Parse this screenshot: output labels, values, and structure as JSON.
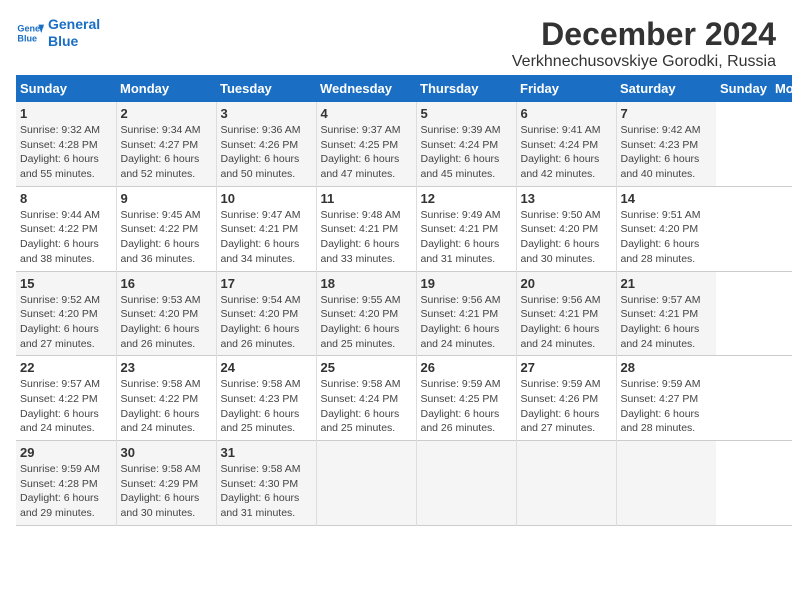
{
  "header": {
    "logo_line1": "General",
    "logo_line2": "Blue",
    "month_title": "December 2024",
    "location": "Verkhnechusovskiye Gorodki, Russia"
  },
  "days_of_week": [
    "Sunday",
    "Monday",
    "Tuesday",
    "Wednesday",
    "Thursday",
    "Friday",
    "Saturday"
  ],
  "weeks": [
    [
      {
        "day": "1",
        "sunrise": "Sunrise: 9:32 AM",
        "sunset": "Sunset: 4:28 PM",
        "daylight": "Daylight: 6 hours and 55 minutes."
      },
      {
        "day": "2",
        "sunrise": "Sunrise: 9:34 AM",
        "sunset": "Sunset: 4:27 PM",
        "daylight": "Daylight: 6 hours and 52 minutes."
      },
      {
        "day": "3",
        "sunrise": "Sunrise: 9:36 AM",
        "sunset": "Sunset: 4:26 PM",
        "daylight": "Daylight: 6 hours and 50 minutes."
      },
      {
        "day": "4",
        "sunrise": "Sunrise: 9:37 AM",
        "sunset": "Sunset: 4:25 PM",
        "daylight": "Daylight: 6 hours and 47 minutes."
      },
      {
        "day": "5",
        "sunrise": "Sunrise: 9:39 AM",
        "sunset": "Sunset: 4:24 PM",
        "daylight": "Daylight: 6 hours and 45 minutes."
      },
      {
        "day": "6",
        "sunrise": "Sunrise: 9:41 AM",
        "sunset": "Sunset: 4:24 PM",
        "daylight": "Daylight: 6 hours and 42 minutes."
      },
      {
        "day": "7",
        "sunrise": "Sunrise: 9:42 AM",
        "sunset": "Sunset: 4:23 PM",
        "daylight": "Daylight: 6 hours and 40 minutes."
      }
    ],
    [
      {
        "day": "8",
        "sunrise": "Sunrise: 9:44 AM",
        "sunset": "Sunset: 4:22 PM",
        "daylight": "Daylight: 6 hours and 38 minutes."
      },
      {
        "day": "9",
        "sunrise": "Sunrise: 9:45 AM",
        "sunset": "Sunset: 4:22 PM",
        "daylight": "Daylight: 6 hours and 36 minutes."
      },
      {
        "day": "10",
        "sunrise": "Sunrise: 9:47 AM",
        "sunset": "Sunset: 4:21 PM",
        "daylight": "Daylight: 6 hours and 34 minutes."
      },
      {
        "day": "11",
        "sunrise": "Sunrise: 9:48 AM",
        "sunset": "Sunset: 4:21 PM",
        "daylight": "Daylight: 6 hours and 33 minutes."
      },
      {
        "day": "12",
        "sunrise": "Sunrise: 9:49 AM",
        "sunset": "Sunset: 4:21 PM",
        "daylight": "Daylight: 6 hours and 31 minutes."
      },
      {
        "day": "13",
        "sunrise": "Sunrise: 9:50 AM",
        "sunset": "Sunset: 4:20 PM",
        "daylight": "Daylight: 6 hours and 30 minutes."
      },
      {
        "day": "14",
        "sunrise": "Sunrise: 9:51 AM",
        "sunset": "Sunset: 4:20 PM",
        "daylight": "Daylight: 6 hours and 28 minutes."
      }
    ],
    [
      {
        "day": "15",
        "sunrise": "Sunrise: 9:52 AM",
        "sunset": "Sunset: 4:20 PM",
        "daylight": "Daylight: 6 hours and 27 minutes."
      },
      {
        "day": "16",
        "sunrise": "Sunrise: 9:53 AM",
        "sunset": "Sunset: 4:20 PM",
        "daylight": "Daylight: 6 hours and 26 minutes."
      },
      {
        "day": "17",
        "sunrise": "Sunrise: 9:54 AM",
        "sunset": "Sunset: 4:20 PM",
        "daylight": "Daylight: 6 hours and 26 minutes."
      },
      {
        "day": "18",
        "sunrise": "Sunrise: 9:55 AM",
        "sunset": "Sunset: 4:20 PM",
        "daylight": "Daylight: 6 hours and 25 minutes."
      },
      {
        "day": "19",
        "sunrise": "Sunrise: 9:56 AM",
        "sunset": "Sunset: 4:21 PM",
        "daylight": "Daylight: 6 hours and 24 minutes."
      },
      {
        "day": "20",
        "sunrise": "Sunrise: 9:56 AM",
        "sunset": "Sunset: 4:21 PM",
        "daylight": "Daylight: 6 hours and 24 minutes."
      },
      {
        "day": "21",
        "sunrise": "Sunrise: 9:57 AM",
        "sunset": "Sunset: 4:21 PM",
        "daylight": "Daylight: 6 hours and 24 minutes."
      }
    ],
    [
      {
        "day": "22",
        "sunrise": "Sunrise: 9:57 AM",
        "sunset": "Sunset: 4:22 PM",
        "daylight": "Daylight: 6 hours and 24 minutes."
      },
      {
        "day": "23",
        "sunrise": "Sunrise: 9:58 AM",
        "sunset": "Sunset: 4:22 PM",
        "daylight": "Daylight: 6 hours and 24 minutes."
      },
      {
        "day": "24",
        "sunrise": "Sunrise: 9:58 AM",
        "sunset": "Sunset: 4:23 PM",
        "daylight": "Daylight: 6 hours and 25 minutes."
      },
      {
        "day": "25",
        "sunrise": "Sunrise: 9:58 AM",
        "sunset": "Sunset: 4:24 PM",
        "daylight": "Daylight: 6 hours and 25 minutes."
      },
      {
        "day": "26",
        "sunrise": "Sunrise: 9:59 AM",
        "sunset": "Sunset: 4:25 PM",
        "daylight": "Daylight: 6 hours and 26 minutes."
      },
      {
        "day": "27",
        "sunrise": "Sunrise: 9:59 AM",
        "sunset": "Sunset: 4:26 PM",
        "daylight": "Daylight: 6 hours and 27 minutes."
      },
      {
        "day": "28",
        "sunrise": "Sunrise: 9:59 AM",
        "sunset": "Sunset: 4:27 PM",
        "daylight": "Daylight: 6 hours and 28 minutes."
      }
    ],
    [
      {
        "day": "29",
        "sunrise": "Sunrise: 9:59 AM",
        "sunset": "Sunset: 4:28 PM",
        "daylight": "Daylight: 6 hours and 29 minutes."
      },
      {
        "day": "30",
        "sunrise": "Sunrise: 9:58 AM",
        "sunset": "Sunset: 4:29 PM",
        "daylight": "Daylight: 6 hours and 30 minutes."
      },
      {
        "day": "31",
        "sunrise": "Sunrise: 9:58 AM",
        "sunset": "Sunset: 4:30 PM",
        "daylight": "Daylight: 6 hours and 31 minutes."
      },
      {
        "day": "",
        "sunrise": "",
        "sunset": "",
        "daylight": ""
      },
      {
        "day": "",
        "sunrise": "",
        "sunset": "",
        "daylight": ""
      },
      {
        "day": "",
        "sunrise": "",
        "sunset": "",
        "daylight": ""
      },
      {
        "day": "",
        "sunrise": "",
        "sunset": "",
        "daylight": ""
      }
    ]
  ]
}
